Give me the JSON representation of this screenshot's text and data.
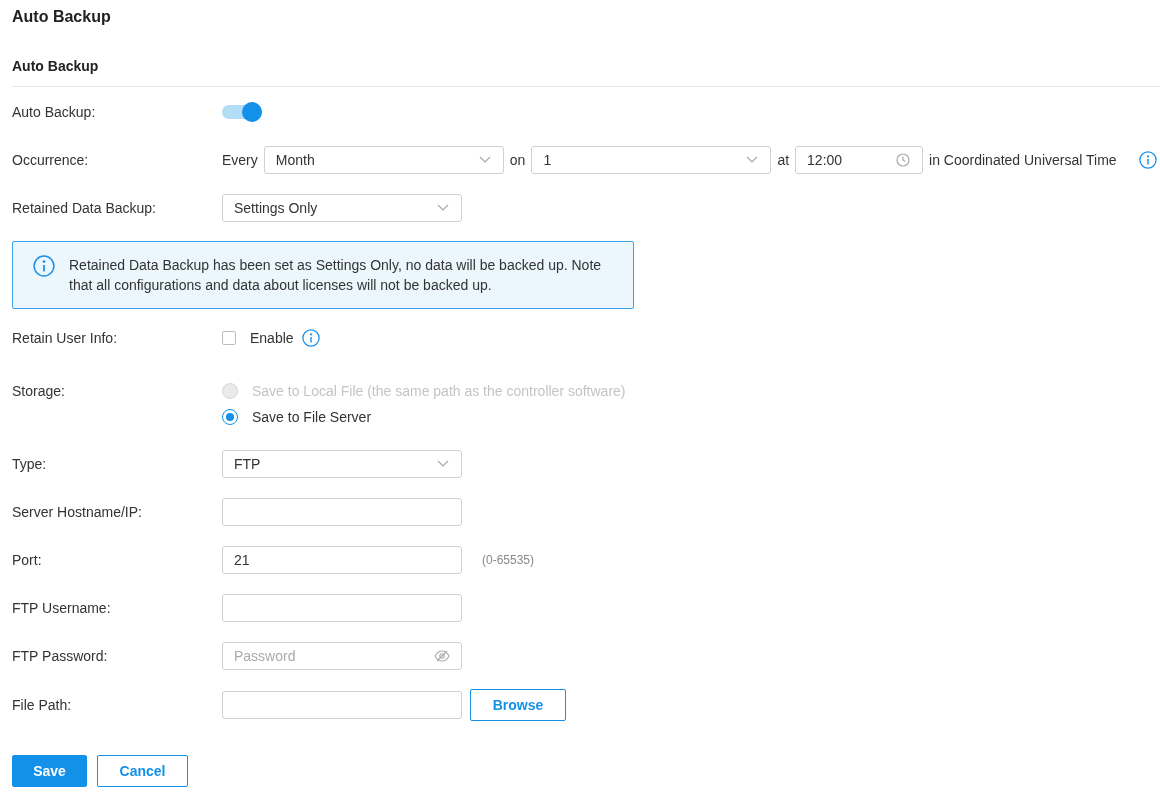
{
  "page_title": "Auto Backup",
  "section_title": "Auto Backup",
  "auto_backup": {
    "label": "Auto Backup:",
    "on": true
  },
  "occurrence": {
    "label": "Occurrence:",
    "every_text": "Every",
    "frequency": "Month",
    "on_text": "on",
    "day": "1",
    "at_text": "at",
    "time": "12:00",
    "timezone_text": "in Coordinated Universal Time"
  },
  "retained_data_backup": {
    "label": "Retained Data Backup:",
    "value": "Settings Only"
  },
  "notice": "Retained Data Backup has been set as Settings Only, no data will be backed up. Note that all configurations and data about licenses will not be backed up.",
  "retain_user_info": {
    "label": "Retain User Info:",
    "option": "Enable",
    "checked": false
  },
  "storage": {
    "label": "Storage:",
    "options": [
      {
        "label": "Save to Local File (the same path as the controller software)",
        "selected": false,
        "disabled": true
      },
      {
        "label": "Save to File Server",
        "selected": true,
        "disabled": false
      }
    ]
  },
  "fields": [
    {
      "kind": "select",
      "label": "Type:",
      "value": "FTP"
    },
    {
      "kind": "text",
      "label": "Server Hostname/IP:"
    },
    {
      "kind": "text",
      "label": "Port:",
      "value": "21",
      "hint": "(0-65535)"
    },
    {
      "kind": "text",
      "label": "FTP Username:"
    },
    {
      "kind": "password",
      "label": "FTP Password:",
      "placeholder": "Password"
    },
    {
      "kind": "browse",
      "label": "File Path:",
      "button": "Browse"
    }
  ],
  "buttons": [
    {
      "kind": "primary",
      "label": "Save"
    },
    {
      "kind": "secondary",
      "label": "Cancel"
    }
  ]
}
